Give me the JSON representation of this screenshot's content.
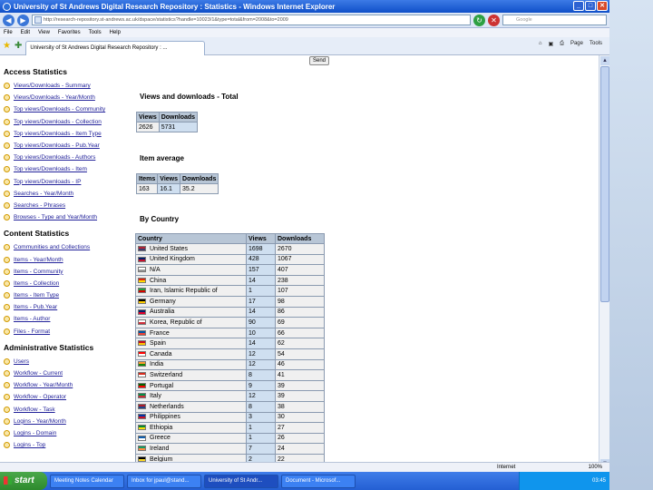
{
  "window": {
    "title": "University of St Andrews Digital Research Repository : Statistics - Windows Internet Explorer"
  },
  "address": {
    "url": "http://research-repository.st-andrews.ac.uk/dspace/statistics?handle=10023/1&type=total&from=2008&to=2009",
    "search_placeholder": "Google"
  },
  "menu": [
    "File",
    "Edit",
    "View",
    "Favorites",
    "Tools",
    "Help"
  ],
  "tab": {
    "label": "University of St Andrews Digital Research Repository : ..."
  },
  "toolbar": {
    "page": "Page",
    "tools": "Tools"
  },
  "send_label": "Send",
  "sidebar": {
    "access": {
      "title": "Access Statistics",
      "items": [
        "Views/Downloads - Summary",
        "Views/Downloads - Year/Month",
        "Top views/Downloads - Community",
        "Top views/Downloads - Collection",
        "Top views/Downloads - Item Type",
        "Top views/Downloads - Pub.Year",
        "Top views/Downloads - Authors",
        "Top views/Downloads - Item",
        "Top views/Downloads - IP",
        "Searches - Year/Month",
        "Searches - Phrases",
        "Browses - Type and Year/Month"
      ]
    },
    "content": {
      "title": "Content Statistics",
      "items": [
        "Communities and Collections",
        "Items - Year/Month",
        "Items - Community",
        "Items - Collection",
        "Items - Item Type",
        "Items - Pub.Year",
        "Items - Author",
        "Files - Format"
      ]
    },
    "admin": {
      "title": "Administrative Statistics",
      "items": [
        "Users",
        "Workflow - Current",
        "Workflow - Year/Month",
        "Workflow - Operator",
        "Workflow - Task",
        "Logins - Year/Month",
        "Logins - Domain",
        "Logins - Top"
      ]
    }
  },
  "total": {
    "title": "Views and downloads - Total",
    "headers": [
      "Views",
      "Downloads"
    ],
    "row": [
      "2626",
      "5731"
    ]
  },
  "average": {
    "title": "Item average",
    "headers": [
      "Items",
      "Views",
      "Downloads"
    ],
    "row": [
      "163",
      "16.1",
      "35.2"
    ]
  },
  "country": {
    "title": "By Country",
    "headers": [
      "Country",
      "Views",
      "Downloads"
    ],
    "rows": [
      {
        "name": "United States",
        "views": "1698",
        "downloads": "2670",
        "colors": [
          "#b22234",
          "#3c3b6e"
        ]
      },
      {
        "name": "United Kingdom",
        "views": "428",
        "downloads": "1067",
        "colors": [
          "#012169",
          "#c8102e"
        ]
      },
      {
        "name": "N/A",
        "views": "157",
        "downloads": "407",
        "colors": [
          "#ffffff",
          "#999999"
        ]
      },
      {
        "name": "China",
        "views": "14",
        "downloads": "238",
        "colors": [
          "#de2910",
          "#ffde00"
        ]
      },
      {
        "name": "Iran, Islamic Republic of",
        "views": "1",
        "downloads": "107",
        "colors": [
          "#239f40",
          "#da0000"
        ]
      },
      {
        "name": "Germany",
        "views": "17",
        "downloads": "98",
        "colors": [
          "#000000",
          "#ffce00"
        ]
      },
      {
        "name": "Australia",
        "views": "14",
        "downloads": "86",
        "colors": [
          "#012169",
          "#e4002b"
        ]
      },
      {
        "name": "Korea, Republic of",
        "views": "90",
        "downloads": "69",
        "colors": [
          "#ffffff",
          "#cd2e3a"
        ]
      },
      {
        "name": "France",
        "views": "10",
        "downloads": "66",
        "colors": [
          "#0055a4",
          "#ef4135"
        ]
      },
      {
        "name": "Spain",
        "views": "14",
        "downloads": "62",
        "colors": [
          "#c60b1e",
          "#ffc400"
        ]
      },
      {
        "name": "Canada",
        "views": "12",
        "downloads": "54",
        "colors": [
          "#ff0000",
          "#ffffff"
        ]
      },
      {
        "name": "India",
        "views": "12",
        "downloads": "46",
        "colors": [
          "#ff9933",
          "#138808"
        ]
      },
      {
        "name": "Switzerland",
        "views": "8",
        "downloads": "41",
        "colors": [
          "#d52b1e",
          "#ffffff"
        ]
      },
      {
        "name": "Portugal",
        "views": "9",
        "downloads": "39",
        "colors": [
          "#006600",
          "#ff0000"
        ]
      },
      {
        "name": "Italy",
        "views": "12",
        "downloads": "39",
        "colors": [
          "#009246",
          "#ce2b37"
        ]
      },
      {
        "name": "Netherlands",
        "views": "8",
        "downloads": "38",
        "colors": [
          "#ae1c28",
          "#21468b"
        ]
      },
      {
        "name": "Philippines",
        "views": "3",
        "downloads": "30",
        "colors": [
          "#0038a8",
          "#ce1126"
        ]
      },
      {
        "name": "Ethiopia",
        "views": "1",
        "downloads": "27",
        "colors": [
          "#078930",
          "#fcdd09"
        ]
      },
      {
        "name": "Greece",
        "views": "1",
        "downloads": "26",
        "colors": [
          "#0d5eaf",
          "#ffffff"
        ]
      },
      {
        "name": "Ireland",
        "views": "7",
        "downloads": "24",
        "colors": [
          "#169b62",
          "#ff883e"
        ]
      },
      {
        "name": "Belgium",
        "views": "2",
        "downloads": "22",
        "colors": [
          "#000000",
          "#fdda24"
        ]
      }
    ]
  },
  "status": {
    "zone": "Internet",
    "zoom": "100%"
  },
  "taskbar": {
    "start": "start",
    "items": [
      "Meeting Notes Calendar",
      "Inbox for jpaul@stand...",
      "University of St Andr...",
      "Document - Microsof..."
    ],
    "tray": "03:45"
  }
}
